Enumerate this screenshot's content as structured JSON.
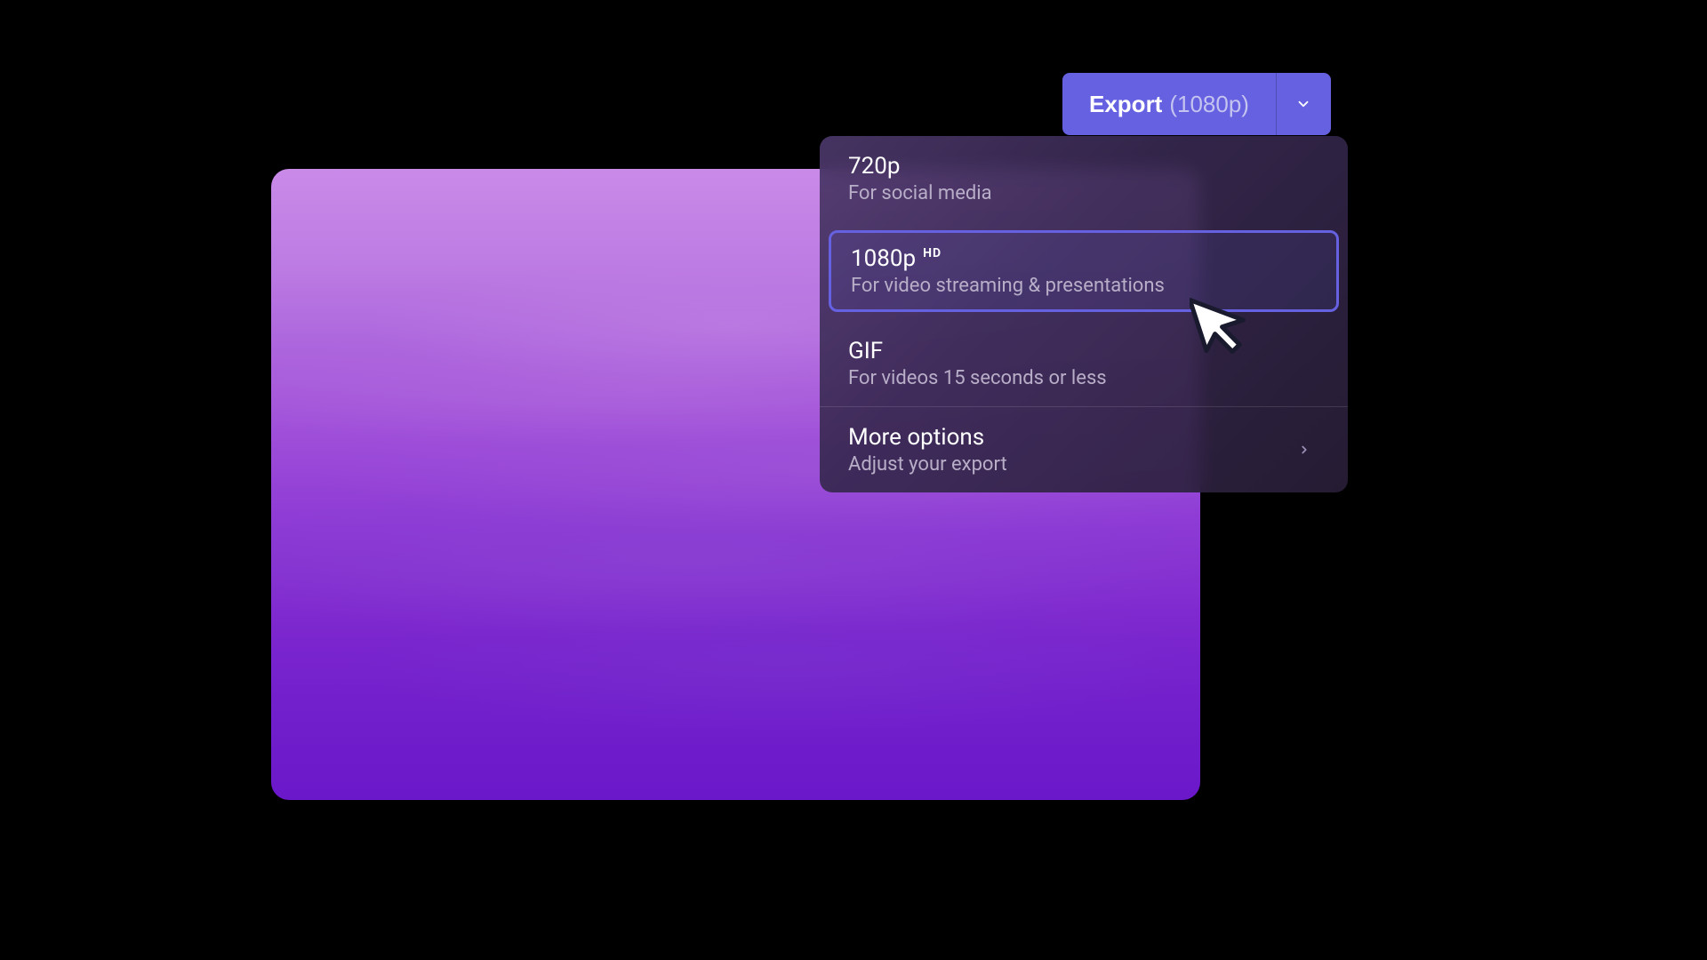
{
  "export_button": {
    "label": "Export",
    "resolution": "(1080p)"
  },
  "dropdown": {
    "options": [
      {
        "title": "720p",
        "subtitle": "For social media",
        "badge": "",
        "selected": false
      },
      {
        "title": "1080p",
        "subtitle": "For video streaming & presentations",
        "badge": "HD",
        "selected": true
      },
      {
        "title": "GIF",
        "subtitle": "For videos 15 seconds or less",
        "badge": "",
        "selected": false
      }
    ],
    "more_options": {
      "title": "More options",
      "subtitle": "Adjust your export"
    }
  },
  "colors": {
    "accent": "#6561e0",
    "text_primary": "#ffffff",
    "text_secondary": "#b8aec8"
  }
}
